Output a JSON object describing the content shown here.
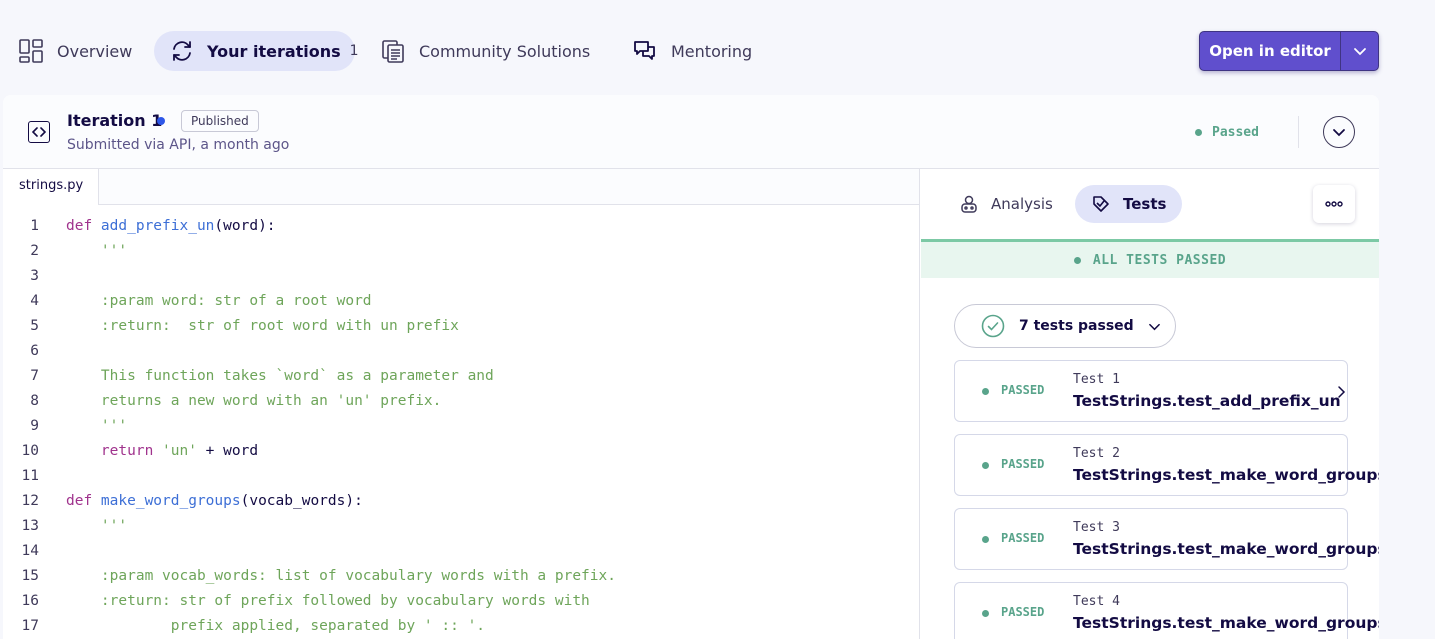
{
  "nav": {
    "tabs": [
      {
        "label": "Overview",
        "icon": "overview-grid-icon"
      },
      {
        "label": "Your iterations",
        "count": "1",
        "icon": "iterations-cycle-icon"
      },
      {
        "label": "Community Solutions",
        "icon": "community-solutions-icon"
      },
      {
        "label": "Mentoring",
        "icon": "mentoring-chat-icon"
      }
    ],
    "open_editor_label": "Open in editor"
  },
  "iteration": {
    "title": "Iteration 1",
    "badge": "Published",
    "submitted": "Submitted via API, a month ago",
    "status": "Passed"
  },
  "editor": {
    "file_name": "strings.py",
    "lines": [
      {
        "n": "1",
        "parts": [
          {
            "t": "def ",
            "c": "kw"
          },
          {
            "t": "add_prefix_un",
            "c": "fn"
          },
          {
            "t": "(word):",
            "c": "src"
          }
        ]
      },
      {
        "n": "2",
        "parts": [
          {
            "t": "    '''",
            "c": "st"
          }
        ]
      },
      {
        "n": "3",
        "parts": []
      },
      {
        "n": "4",
        "parts": [
          {
            "t": "    :param word: str of a root word",
            "c": "st"
          }
        ]
      },
      {
        "n": "5",
        "parts": [
          {
            "t": "    :return:  str of root word with un prefix",
            "c": "st"
          }
        ]
      },
      {
        "n": "6",
        "parts": []
      },
      {
        "n": "7",
        "parts": [
          {
            "t": "    This function takes `word` as a parameter and",
            "c": "st"
          }
        ]
      },
      {
        "n": "8",
        "parts": [
          {
            "t": "    returns a new word with an 'un' prefix.",
            "c": "st"
          }
        ]
      },
      {
        "n": "9",
        "parts": [
          {
            "t": "    '''",
            "c": "st"
          }
        ]
      },
      {
        "n": "10",
        "parts": [
          {
            "t": "    return ",
            "c": "kw"
          },
          {
            "t": "'un'",
            "c": "st"
          },
          {
            "t": " + word",
            "c": "src"
          }
        ]
      },
      {
        "n": "11",
        "parts": []
      },
      {
        "n": "12",
        "parts": [
          {
            "t": "def ",
            "c": "kw"
          },
          {
            "t": "make_word_groups",
            "c": "fn"
          },
          {
            "t": "(vocab_words):",
            "c": "src"
          }
        ]
      },
      {
        "n": "13",
        "parts": [
          {
            "t": "    '''",
            "c": "st"
          }
        ]
      },
      {
        "n": "14",
        "parts": []
      },
      {
        "n": "15",
        "parts": [
          {
            "t": "    :param vocab_words: list of vocabulary words with a prefix.",
            "c": "st"
          }
        ]
      },
      {
        "n": "16",
        "parts": [
          {
            "t": "    :return: str of prefix followed by vocabulary words with",
            "c": "st"
          }
        ]
      },
      {
        "n": "17",
        "parts": [
          {
            "t": "            prefix applied, separated by ' :: '.",
            "c": "st"
          }
        ]
      }
    ]
  },
  "results": {
    "tabs": [
      {
        "label": "Analysis",
        "icon": "analysis-robot-icon"
      },
      {
        "label": "Tests",
        "icon": "tests-tag-icon"
      }
    ],
    "banner": "ALL TESTS PASSED",
    "summary": "7 tests passed",
    "tests": [
      {
        "status": "PASSED",
        "number": "Test 1",
        "name": "TestStrings.test_add_prefix_un"
      },
      {
        "status": "PASSED",
        "number": "Test 2",
        "name": "TestStrings.test_make_word_groups_a"
      },
      {
        "status": "PASSED",
        "number": "Test 3",
        "name": "TestStrings.test_make_word_groups_e"
      },
      {
        "status": "PASSED",
        "number": "Test 4",
        "name": "TestStrings.test_make_word_groups_p"
      }
    ]
  },
  "colors": {
    "accent": "#604fcd",
    "passed": "#59a48b",
    "active_tab_bg": "#e1e4f9",
    "published_dot": "#2e57e8"
  }
}
